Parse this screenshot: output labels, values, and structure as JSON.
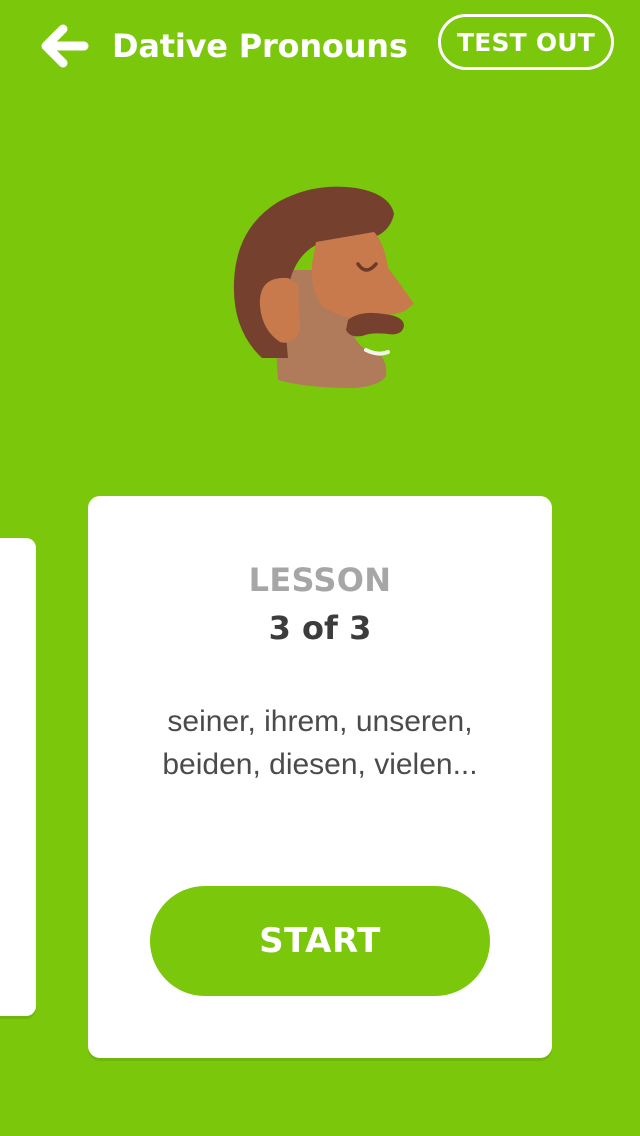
{
  "header": {
    "back_icon": "arrow-left-icon",
    "title": "Dative Pronouns",
    "test_out_label": "TEST OUT"
  },
  "skill_avatar": {
    "icon": "man-profile-head-icon"
  },
  "lesson_card": {
    "label": "LESSON",
    "progress": "3 of 3",
    "words": "seiner, ihrem, unseren, beiden, diesen, vielen...",
    "start_label": "START"
  },
  "colors": {
    "background": "#7AC70C",
    "card": "#FFFFFF",
    "lesson_label": "#A6A6A6",
    "progress_text": "#3C3C3C",
    "words_text": "#4B4B4B",
    "button": "#7AC70C"
  }
}
